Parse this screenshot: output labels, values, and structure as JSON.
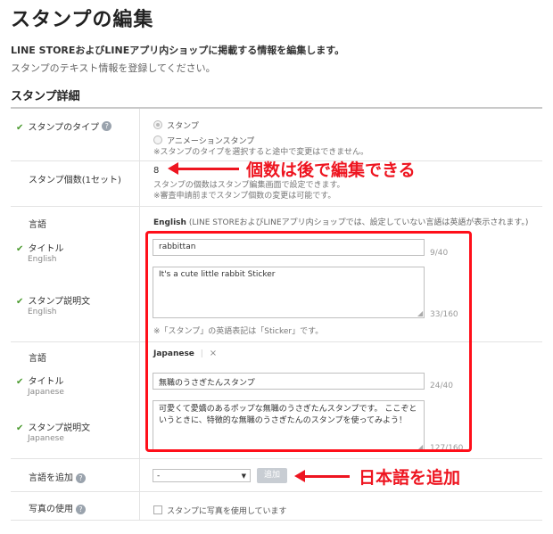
{
  "page": {
    "title": "スタンプの編集",
    "subtitle": "LINE STOREおよびLINEアプリ内ショップに掲載する情報を編集します。",
    "description": "スタンプのテキスト情報を登録してください。",
    "section_title": "スタンプ詳細"
  },
  "type_row": {
    "label": "スタンプのタイプ",
    "options": [
      "スタンプ",
      "アニメーションスタンプ"
    ],
    "selected": "スタンプ",
    "note": "※スタンプのタイプを選択すると途中で変更はできません。"
  },
  "count_row": {
    "label": "スタンプ個数(1セット)",
    "value": "8",
    "note1": "スタンプの個数はスタンプ編集画面で設定できます。",
    "note2": "※審査申請前までスタンプ個数の変更は可能です。"
  },
  "english": {
    "lang_label": "言語",
    "lang_name": "English",
    "lang_note": "(LINE STOREおよびLINEアプリ内ショップでは、設定していない言語は英語が表示されます。)",
    "title_label": "タイトル",
    "title_sub": "English",
    "title_value": "rabbittan",
    "title_count": "9/40",
    "desc_label": "スタンプ説明文",
    "desc_sub": "English",
    "desc_value": "It's a cute little rabbit Sticker",
    "desc_count": "33/160",
    "hint": "※「スタンプ」の英語表記は「Sticker」です。"
  },
  "japanese": {
    "lang_label": "言語",
    "lang_name": "Japanese",
    "remove": "×",
    "title_label": "タイトル",
    "title_sub": "Japanese",
    "title_value": "無職のうさぎたんスタンプ",
    "title_count": "24/40",
    "desc_label": "スタンプ説明文",
    "desc_sub": "Japanese",
    "desc_value": "可愛くて愛嬌のあるポップな無職のうさぎたんスタンプです。 ここぞというときに、特徴的な無職のうさぎたんのスタンプを使ってみよう！",
    "desc_count": "127/160"
  },
  "add_lang": {
    "label": "言語を追加",
    "select_value": "-",
    "button": "追加"
  },
  "photo": {
    "label": "写真の使用",
    "checkbox_label": "スタンプに写真を使用しています"
  },
  "annotations": {
    "count_note": "個数は後で編集できる",
    "add_note": "日本語を追加",
    "color": "#ee1520"
  },
  "icons": {
    "check": "checkmark-icon",
    "help": "question-icon",
    "arrow": "left-arrow-icon"
  }
}
